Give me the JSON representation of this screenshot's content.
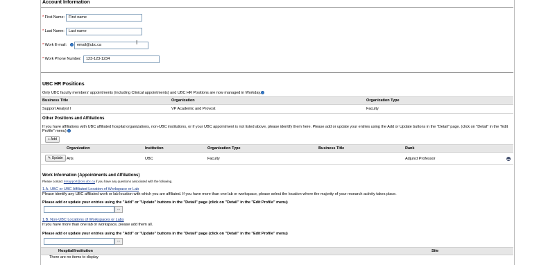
{
  "account": {
    "title": "Account Information",
    "first_name_label": "First Name:",
    "first_name_value": "First name",
    "last_name_label": "Last Name:",
    "last_name_value": "Last name",
    "email_label": "Work E-mail:",
    "email_value": "email@ubc.ca",
    "phone_label": "Work Phone Number:",
    "phone_value": "123-123-1234",
    "required_mark": "*"
  },
  "hr_positions": {
    "title": "UBC HR Positions",
    "note": "Only UBC faculty members' appointments (including Clinical appointments) and UBC HR Positions are now managed in Workday.",
    "columns": [
      "Business Title",
      "Organization",
      "Organization Type"
    ],
    "rows": [
      [
        "Support Analyst I",
        "VP Academic and Provost",
        "Faculty"
      ]
    ]
  },
  "other_positions": {
    "title": "Other Positions and Affiliations",
    "note_line1": "If you have affiliations with UBC affiliated hospital organizations, non-UBC institutions, or if your UBC appointment is not listed above, please identify them here. Please add or update your entries using the Add or Update buttons in the \"Detail\" page. (click on \"Detail\" in the \"Edit",
    "note_line2": "Profile\" menu)",
    "add_button": "Add",
    "columns": [
      "Organization",
      "Institution",
      "Organization Type",
      "Business Title",
      "Rank"
    ],
    "rows": [
      {
        "update_label": "Update",
        "organization": "Arts",
        "institution": "UBC",
        "org_type": "Faculty",
        "business_title": "",
        "rank": "Adjunct Professor"
      }
    ]
  },
  "work_info": {
    "title": "Work Information (Appointments and Affiliations)",
    "contact_prefix": "Please contact",
    "contact_link": "rissupport@ors.ubc.ca",
    "contact_suffix": "if you have any questions associated with the following.",
    "section_a_link": "1.A. UBC or UBC Affiliated Location of Workspace or Lab",
    "section_a_desc": "Please identify any UBC affiliated work or lab location with which you are affiliated. If you have more than one lab or workspace, please select the location where the majority of your research activity takes place.",
    "instruction": "Please add or update your entries using the \"Add\" or \"Update\" buttons in the \"Detail\" page (click on \"Detail\" in the \"Edit Profile\" menu)",
    "ellipsis": "...",
    "section_b_link": "1.B. Non-UBC Locations of Workspaces or Labs",
    "section_b_desc": "If you have more than one lab or workspace, please add them all.",
    "table_columns": [
      "Hospital/Institution",
      "Site"
    ],
    "empty_text": "There are no items to display"
  }
}
